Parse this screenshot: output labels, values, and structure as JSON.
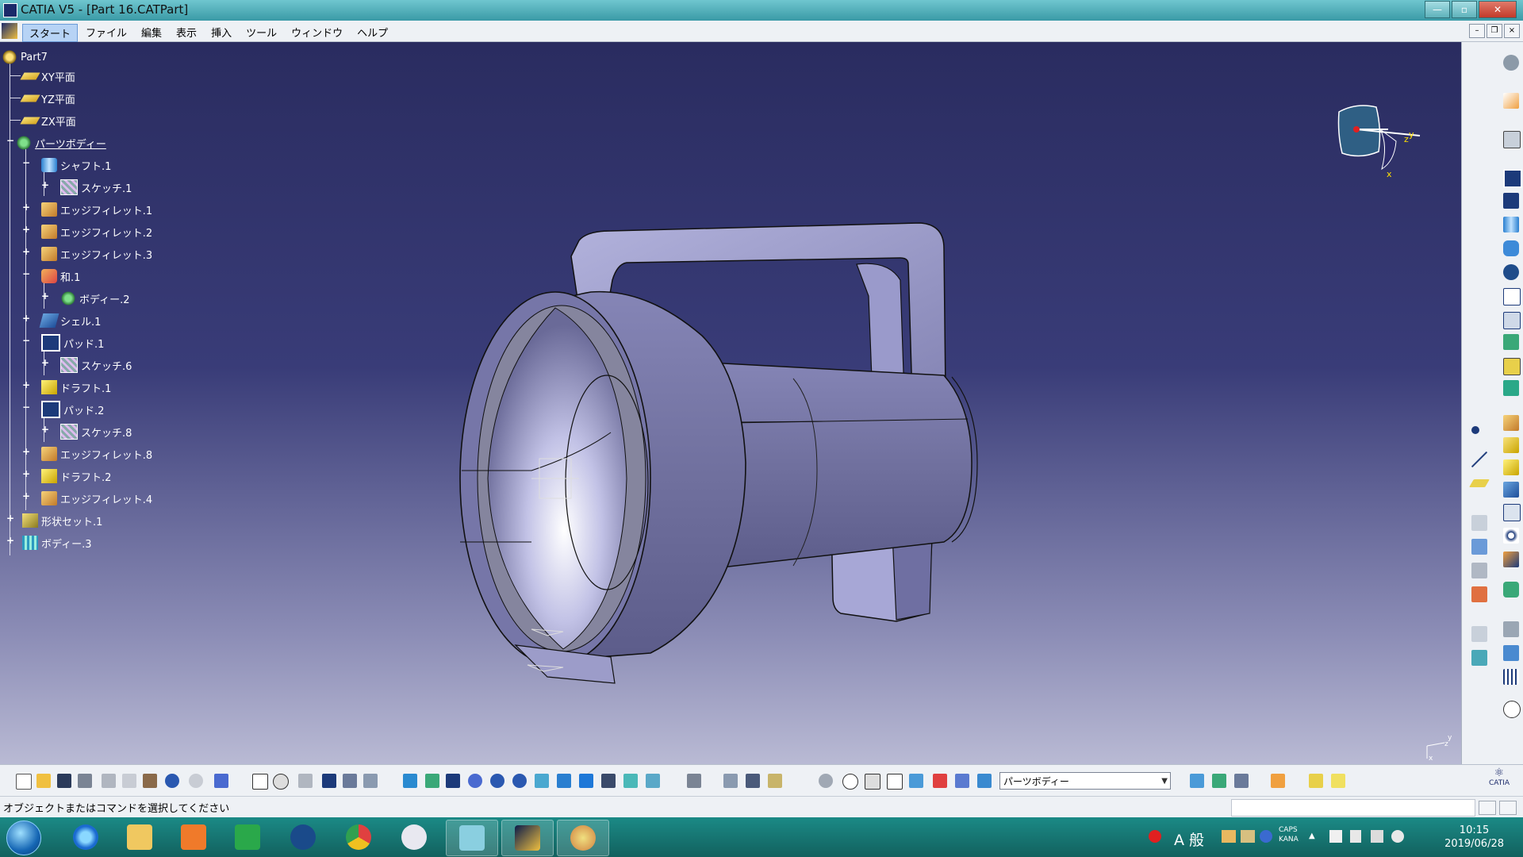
{
  "window": {
    "title": "CATIA V5 - [Part 16.CATPart]"
  },
  "menu": [
    "スタート",
    "ファイル",
    "編集",
    "表示",
    "挿入",
    "ツール",
    "ウィンドウ",
    "ヘルプ"
  ],
  "menu_active": "スタート",
  "tree": {
    "root": "Part7",
    "items": [
      {
        "label": "XY平面",
        "icon": "plane-icon"
      },
      {
        "label": "YZ平面",
        "icon": "plane-icon"
      },
      {
        "label": "ZX平面",
        "icon": "plane-icon"
      },
      {
        "label": "パーツボディー",
        "icon": "body-gear-icon"
      },
      {
        "label": "シャフト.1",
        "icon": "shaft-icon"
      },
      {
        "label": "スケッチ.1",
        "icon": "sketch-icon"
      },
      {
        "label": "エッジフィレット.1",
        "icon": "fillet-icon"
      },
      {
        "label": "エッジフィレット.2",
        "icon": "fillet-icon"
      },
      {
        "label": "エッジフィレット.3",
        "icon": "fillet-icon"
      },
      {
        "label": "和.1",
        "icon": "boolean-add-icon"
      },
      {
        "label": "ボディー.2",
        "icon": "body-gear-icon"
      },
      {
        "label": "シェル.1",
        "icon": "shell-icon"
      },
      {
        "label": "パッド.1",
        "icon": "pad-icon"
      },
      {
        "label": "スケッチ.6",
        "icon": "sketch-icon"
      },
      {
        "label": "ドラフト.1",
        "icon": "draft-icon"
      },
      {
        "label": "パッド.2",
        "icon": "pad-icon"
      },
      {
        "label": "スケッチ.8",
        "icon": "sketch-icon"
      },
      {
        "label": "エッジフィレット.8",
        "icon": "fillet-icon"
      },
      {
        "label": "ドラフト.2",
        "icon": "draft-icon"
      },
      {
        "label": "エッジフィレット.4",
        "icon": "fillet-icon"
      },
      {
        "label": "形状セット.1",
        "icon": "geometrical-set-icon"
      },
      {
        "label": "ボディー.3",
        "icon": "body-icon"
      }
    ]
  },
  "compass": {
    "x": "x",
    "y": "y",
    "z": "z"
  },
  "mini_axis": {
    "x": "x",
    "y": "y",
    "z": "z"
  },
  "toolbar": {
    "current_body": "パーツボディー"
  },
  "catia_logo": "CATIA",
  "status": {
    "message": "オブジェクトまたはコマンドを選択してください"
  },
  "taskbar": {
    "apps": [
      "internet-explorer-icon",
      "file-explorer-icon",
      "media-player-icon",
      "stock-app-icon",
      "wifi-app-icon",
      "chrome-icon",
      "snipping-tool-icon",
      "notepad-app-icon",
      "catia-app-icon",
      "paint-icon"
    ],
    "ime": "A 般",
    "caps": "CAPS",
    "kana": "KANA",
    "time": "10:15",
    "date": "2019/06/28"
  }
}
